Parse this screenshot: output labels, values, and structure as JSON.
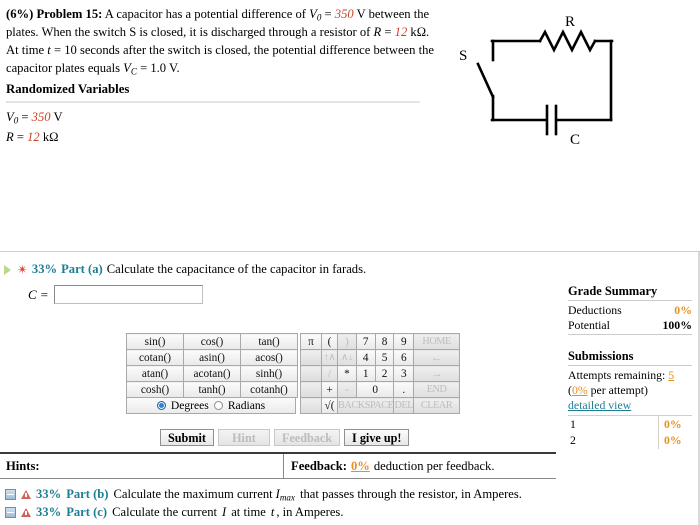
{
  "problem": {
    "percent": "(6%)",
    "label": "Problem 15:",
    "line1_a": "A capacitor has a potential difference of",
    "v0_sym": "V",
    "v0_sub": "0",
    "v0_eq": "=",
    "v0_value": "350",
    "v0_unit": "V",
    "line2": "between the plates. When the switch S is closed, it is discharged through a",
    "line3_a": "resistor of",
    "r_sym": "R",
    "r_eq": "=",
    "r_value": "12",
    "r_unit": "kΩ.",
    "line3_b": "At time",
    "t_sym": "t",
    "line3_c": "= 10 seconds after the switch is closed, the",
    "line4_a": "potential difference between the capacitor plates equals",
    "vc_sym": "V",
    "vc_sub": "C",
    "vc_eq": "=",
    "vc_value": "1.0 V."
  },
  "randomized": {
    "title": "Randomized Variables",
    "v0_sym": "V",
    "v0_sub": "0",
    "v0_eq": "=",
    "v0_value": "350",
    "v0_unit": "V",
    "r_sym": "R",
    "r_eq": "=",
    "r_value": "12",
    "r_unit": "kΩ"
  },
  "figure": {
    "resistor_label": "R",
    "switch_label": "S",
    "capacitor_label": "C"
  },
  "part_a": {
    "percent": "33%",
    "name": "Part (a)",
    "prompt": "Calculate the capacitance of the capacitor in farads.",
    "answer_label": "C =",
    "answer_value": "",
    "answer_placeholder": "",
    "play_icon": "play-triangle-icon",
    "status_icon": "red-asterisk-icon"
  },
  "keypad": {
    "functions": [
      [
        "sin()",
        "cos()",
        "tan()"
      ],
      [
        "cotan()",
        "asin()",
        "acos()"
      ],
      [
        "atan()",
        "acotan()",
        "sinh()"
      ],
      [
        "cosh()",
        "tanh()",
        "cotanh()"
      ]
    ],
    "degrees_label": "Degrees",
    "radians_label": "Radians",
    "selected_angle_mode": "Degrees",
    "numpad": {
      "row1": [
        "π",
        "(",
        ")",
        "7",
        "8",
        "9",
        "HOME"
      ],
      "row2": [
        "",
        "↑∧",
        "∧↓",
        "4",
        "5",
        "6",
        "←"
      ],
      "row3": [
        "",
        "/",
        "*",
        "1",
        "2",
        "3",
        "→"
      ],
      "row4": [
        "",
        "+",
        "-",
        "0",
        ".",
        "END"
      ],
      "row5": [
        "",
        "√(",
        "BACKSPACE",
        "DEL",
        "CLEAR"
      ]
    }
  },
  "buttons": {
    "submit": "Submit",
    "hint": "Hint",
    "feedback": "Feedback",
    "give_up": "I give up!"
  },
  "grade_summary": {
    "title": "Grade Summary",
    "deductions_label": "Deductions",
    "deductions_value": "0%",
    "potential_label": "Potential",
    "potential_value": "100%",
    "submissions_title": "Submissions",
    "attempts_label": "Attempts remaining:",
    "attempts_value": "5",
    "per_attempt_open": "(",
    "per_attempt_pct": "0%",
    "per_attempt_text": " per attempt)",
    "detailed_view": "detailed view",
    "rows": [
      {
        "n": "1",
        "v": "0%"
      },
      {
        "n": "2",
        "v": "0%"
      }
    ]
  },
  "hints_bar": {
    "hints_label": "Hints:",
    "feedback_label": "Feedback:",
    "feedback_pct": "0%",
    "feedback_text": "deduction per feedback."
  },
  "part_b": {
    "percent": "33%",
    "name": "Part (b)",
    "prompt_a": "Calculate the maximum current",
    "sym": "I",
    "sym_sub": "max",
    "prompt_b": "that passes through the resistor, in Amperes."
  },
  "part_c": {
    "percent": "33%",
    "name": "Part (c)",
    "prompt_a": "Calculate the current",
    "sym": "I",
    "prompt_mid": "at time",
    "sym_t": "t",
    "prompt_b": ", in Amperes."
  },
  "colors": {
    "accent_teal": "#1c7e92",
    "value_red": "#cf4124",
    "orange": "#e79022"
  }
}
